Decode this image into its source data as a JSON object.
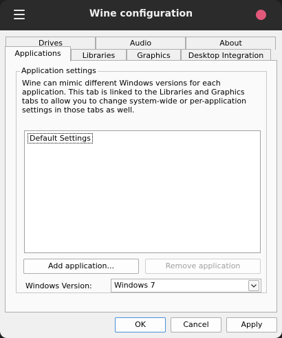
{
  "window": {
    "title": "Wine configuration"
  },
  "tabs_row1": [
    "Drives",
    "Audio",
    "About"
  ],
  "tabs_row2": [
    "Applications",
    "Libraries",
    "Graphics",
    "Desktop Integration"
  ],
  "app_settings": {
    "group_title": "Application settings",
    "description": "Wine can mimic different Windows versions for each application. This tab is linked to the Libraries and Graphics tabs to allow you to change system-wide or per-application settings in those tabs as well.",
    "list_items": [
      "Default Settings"
    ],
    "add_button": "Add application...",
    "remove_button": "Remove application",
    "version_label": "Windows Version:",
    "version_value": "Windows 7"
  },
  "dialog_buttons": {
    "ok": "OK",
    "cancel": "Cancel",
    "apply": "Apply"
  },
  "colors": {
    "close_button": "#e1587a",
    "titlebar": "#2b2b2b",
    "client_bg": "#f0f0f0"
  }
}
